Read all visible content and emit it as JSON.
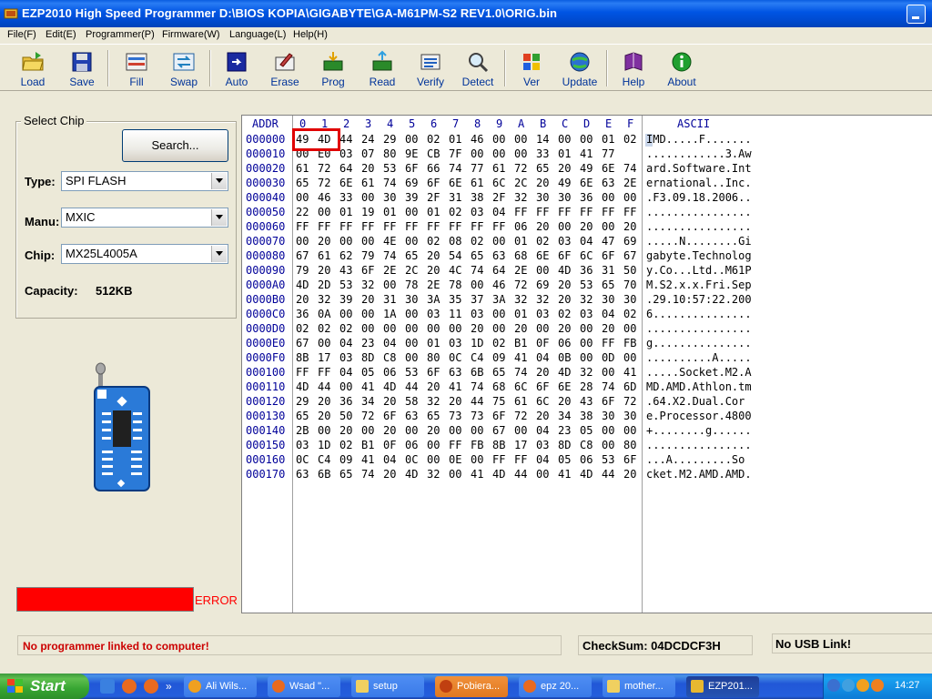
{
  "window": {
    "title": "EZP2010 High Speed Programmer    D:\\BIOS KOPIA\\GIGABYTE\\GA-M61PM-S2 REV1.0\\ORIG.bin"
  },
  "menu": [
    "File(F)",
    "Edit(E)",
    "Programmer(P)",
    "Firmware(W)",
    "Language(L)",
    "Help(H)"
  ],
  "toolbar": {
    "load": "Load",
    "save": "Save",
    "fill": "Fill",
    "swap": "Swap",
    "auto": "Auto",
    "erase": "Erase",
    "prog": "Prog",
    "read": "Read",
    "verify": "Verify",
    "detect": "Detect",
    "ver": "Ver",
    "update": "Update",
    "help": "Help",
    "about": "About"
  },
  "chip_panel": {
    "title": "Select Chip",
    "search_label": "Search...",
    "type_label": "Type:",
    "type_value": "SPI FLASH",
    "manu_label": "Manu:",
    "manu_value": "MXIC",
    "chip_label": "Chip:",
    "chip_value": "MX25L4005A",
    "capacity_label": "Capacity:",
    "capacity_value": "512KB"
  },
  "error_label": "ERROR",
  "hex": {
    "addr_header": "ADDR",
    "ascii_header": "ASCII",
    "columns": [
      "0",
      "1",
      "2",
      "3",
      "4",
      "5",
      "6",
      "7",
      "8",
      "9",
      "A",
      "B",
      "C",
      "D",
      "E",
      "F"
    ],
    "rows": [
      {
        "addr": "000000",
        "bytes": [
          "49",
          "4D",
          "44",
          "24",
          "29",
          "00",
          "02",
          "01",
          "46",
          "00",
          "00",
          "14",
          "00",
          "00",
          "01",
          "02"
        ],
        "ascii": "IMD.....F......."
      },
      {
        "addr": "000010",
        "bytes": [
          "00",
          "E0",
          "03",
          "07",
          "80",
          "9E",
          "CB",
          "7F",
          "00",
          "00",
          "00",
          "33",
          "01",
          "41",
          "77"
        ],
        "ascii": "............3.Aw"
      },
      {
        "addr": "000020",
        "bytes": [
          "61",
          "72",
          "64",
          "20",
          "53",
          "6F",
          "66",
          "74",
          "77",
          "61",
          "72",
          "65",
          "20",
          "49",
          "6E",
          "74"
        ],
        "ascii": "ard.Software.Int"
      },
      {
        "addr": "000030",
        "bytes": [
          "65",
          "72",
          "6E",
          "61",
          "74",
          "69",
          "6F",
          "6E",
          "61",
          "6C",
          "2C",
          "20",
          "49",
          "6E",
          "63",
          "2E"
        ],
        "ascii": "ernational..Inc."
      },
      {
        "addr": "000040",
        "bytes": [
          "00",
          "46",
          "33",
          "00",
          "30",
          "39",
          "2F",
          "31",
          "38",
          "2F",
          "32",
          "30",
          "30",
          "36",
          "00",
          "00"
        ],
        "ascii": ".F3.09.18.2006.."
      },
      {
        "addr": "000050",
        "bytes": [
          "22",
          "00",
          "01",
          "19",
          "01",
          "00",
          "01",
          "02",
          "03",
          "04",
          "FF",
          "FF",
          "FF",
          "FF",
          "FF",
          "FF"
        ],
        "ascii": "................"
      },
      {
        "addr": "000060",
        "bytes": [
          "FF",
          "FF",
          "FF",
          "FF",
          "FF",
          "FF",
          "FF",
          "FF",
          "FF",
          "FF",
          "06",
          "20",
          "00",
          "20",
          "00",
          "20"
        ],
        "ascii": "................"
      },
      {
        "addr": "000070",
        "bytes": [
          "00",
          "20",
          "00",
          "00",
          "4E",
          "00",
          "02",
          "08",
          "02",
          "00",
          "01",
          "02",
          "03",
          "04",
          "47",
          "69"
        ],
        "ascii": ".....N........Gi"
      },
      {
        "addr": "000080",
        "bytes": [
          "67",
          "61",
          "62",
          "79",
          "74",
          "65",
          "20",
          "54",
          "65",
          "63",
          "68",
          "6E",
          "6F",
          "6C",
          "6F",
          "67"
        ],
        "ascii": "gabyte.Technolog"
      },
      {
        "addr": "000090",
        "bytes": [
          "79",
          "20",
          "43",
          "6F",
          "2E",
          "2C",
          "20",
          "4C",
          "74",
          "64",
          "2E",
          "00",
          "4D",
          "36",
          "31",
          "50"
        ],
        "ascii": "y.Co...Ltd..M61P"
      },
      {
        "addr": "0000A0",
        "bytes": [
          "4D",
          "2D",
          "53",
          "32",
          "00",
          "78",
          "2E",
          "78",
          "00",
          "46",
          "72",
          "69",
          "20",
          "53",
          "65",
          "70"
        ],
        "ascii": "M.S2.x.x.Fri.Sep"
      },
      {
        "addr": "0000B0",
        "bytes": [
          "20",
          "32",
          "39",
          "20",
          "31",
          "30",
          "3A",
          "35",
          "37",
          "3A",
          "32",
          "32",
          "20",
          "32",
          "30",
          "30"
        ],
        "ascii": ".29.10:57:22.200"
      },
      {
        "addr": "0000C0",
        "bytes": [
          "36",
          "0A",
          "00",
          "00",
          "1A",
          "00",
          "03",
          "11",
          "03",
          "00",
          "01",
          "03",
          "02",
          "03",
          "04",
          "02"
        ],
        "ascii": "6..............."
      },
      {
        "addr": "0000D0",
        "bytes": [
          "02",
          "02",
          "02",
          "00",
          "00",
          "00",
          "00",
          "00",
          "20",
          "00",
          "20",
          "00",
          "20",
          "00",
          "20",
          "00"
        ],
        "ascii": "................"
      },
      {
        "addr": "0000E0",
        "bytes": [
          "67",
          "00",
          "04",
          "23",
          "04",
          "00",
          "01",
          "03",
          "1D",
          "02",
          "B1",
          "0F",
          "06",
          "00",
          "FF",
          "FB"
        ],
        "ascii": "g..............."
      },
      {
        "addr": "0000F0",
        "bytes": [
          "8B",
          "17",
          "03",
          "8D",
          "C8",
          "00",
          "80",
          "0C",
          "C4",
          "09",
          "41",
          "04",
          "0B",
          "00",
          "0D",
          "00"
        ],
        "ascii": "..........A....."
      },
      {
        "addr": "000100",
        "bytes": [
          "FF",
          "FF",
          "04",
          "05",
          "06",
          "53",
          "6F",
          "63",
          "6B",
          "65",
          "74",
          "20",
          "4D",
          "32",
          "00",
          "41"
        ],
        "ascii": ".....Socket.M2.A"
      },
      {
        "addr": "000110",
        "bytes": [
          "4D",
          "44",
          "00",
          "41",
          "4D",
          "44",
          "20",
          "41",
          "74",
          "68",
          "6C",
          "6F",
          "6E",
          "28",
          "74",
          "6D"
        ],
        "ascii": "MD.AMD.Athlon.tm"
      },
      {
        "addr": "000120",
        "bytes": [
          "29",
          "20",
          "36",
          "34",
          "20",
          "58",
          "32",
          "20",
          "44",
          "75",
          "61",
          "6C",
          "20",
          "43",
          "6F",
          "72"
        ],
        "ascii": ".64.X2.Dual.Cor"
      },
      {
        "addr": "000130",
        "bytes": [
          "65",
          "20",
          "50",
          "72",
          "6F",
          "63",
          "65",
          "73",
          "73",
          "6F",
          "72",
          "20",
          "34",
          "38",
          "30",
          "30"
        ],
        "ascii": "e.Processor.4800"
      },
      {
        "addr": "000140",
        "bytes": [
          "2B",
          "00",
          "20",
          "00",
          "20",
          "00",
          "20",
          "00",
          "00",
          "67",
          "00",
          "04",
          "23",
          "05",
          "00",
          "00"
        ],
        "ascii": "+........g......"
      },
      {
        "addr": "000150",
        "bytes": [
          "03",
          "1D",
          "02",
          "B1",
          "0F",
          "06",
          "00",
          "FF",
          "FB",
          "8B",
          "17",
          "03",
          "8D",
          "C8",
          "00",
          "80"
        ],
        "ascii": "................"
      },
      {
        "addr": "000160",
        "bytes": [
          "0C",
          "C4",
          "09",
          "41",
          "04",
          "0C",
          "00",
          "0E",
          "00",
          "FF",
          "FF",
          "04",
          "05",
          "06",
          "53",
          "6F"
        ],
        "ascii": "...A.........So"
      },
      {
        "addr": "000170",
        "bytes": [
          "63",
          "6B",
          "65",
          "74",
          "20",
          "4D",
          "32",
          "00",
          "41",
          "4D",
          "44",
          "00",
          "41",
          "4D",
          "44",
          "20"
        ],
        "ascii": "cket.M2.AMD.AMD."
      }
    ]
  },
  "status": {
    "message": "No programmer linked to computer!",
    "checksum": "CheckSum: 04DCDCF3H",
    "usb": "No USB Link!"
  },
  "taskbar": {
    "start": "Start",
    "tasks": [
      "Ali Wils...",
      "Wsad \"...",
      "setup",
      "Pobiera...",
      "epz 20...",
      "mother...",
      "EZP201..."
    ],
    "clock": "14:27"
  },
  "colors": {
    "titlebar": "#0054e3",
    "error": "#ff0000",
    "selection": "#e00000",
    "status_text": "#cc0000"
  }
}
